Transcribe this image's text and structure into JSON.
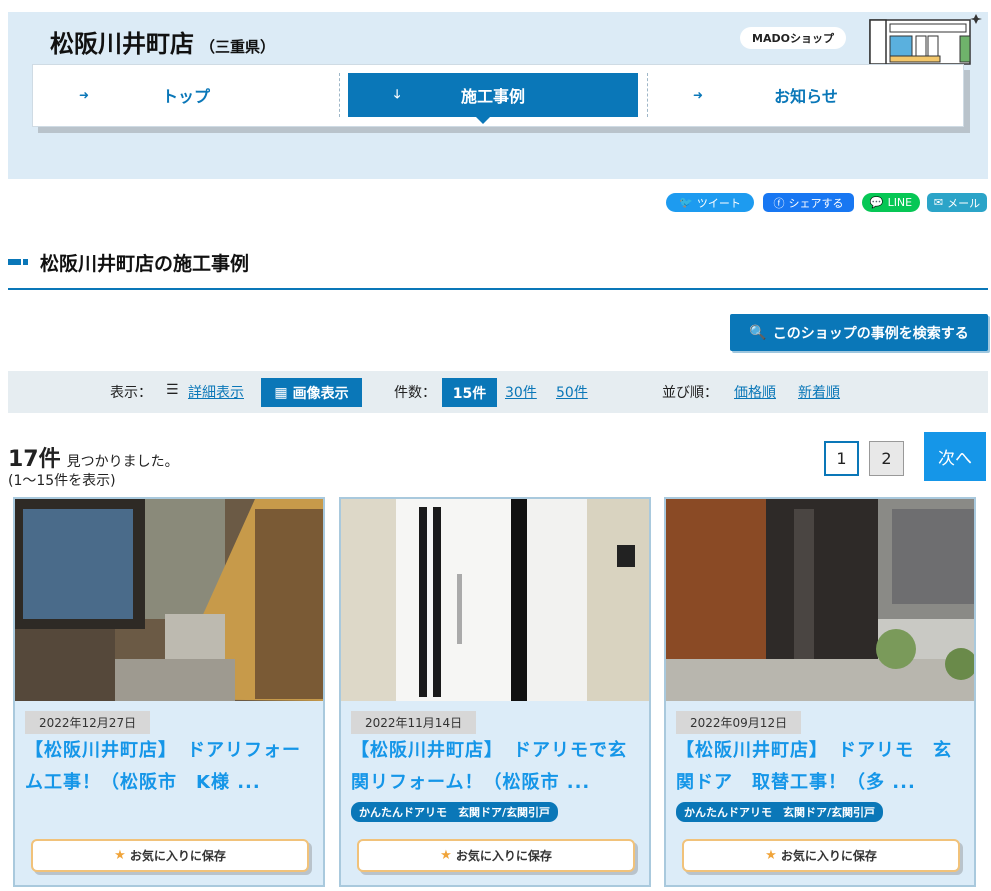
{
  "header": {
    "shop_name": "松阪川井町店",
    "prefecture": "（三重県）",
    "badge": "MADOショップ"
  },
  "nav": {
    "items": [
      {
        "label": "トップ"
      },
      {
        "label": "施工事例"
      },
      {
        "label": "お知らせ"
      }
    ]
  },
  "share": {
    "tweet": "ツイート",
    "facebook": "シェアする",
    "line": "LINE",
    "mail": "メール"
  },
  "section": {
    "title": "松阪川井町店の施工事例",
    "search_button": "このショップの事例を検索する"
  },
  "filter": {
    "display_label": "表示：",
    "detail": "詳細表示",
    "image": "画像表示",
    "count_label": "件数：",
    "count_options": [
      "15件",
      "30件",
      "50件"
    ],
    "sort_label": "並び順：",
    "sort_price": "価格順",
    "sort_new": "新着順"
  },
  "results": {
    "count": "17件",
    "found": "見つかりました。",
    "range": "(1〜15件を表示)",
    "pages": [
      "1",
      "2"
    ],
    "next": "次へ"
  },
  "cards": [
    {
      "date": "2022年12月27日",
      "title": "【松阪川井町店】　ドアリフォーム工事！（松阪市　K様 ...",
      "tag": "",
      "fav": "お気に入りに保存"
    },
    {
      "date": "2022年11月14日",
      "title": "【松阪川井町店】　ドアリモで玄関リフォーム！（松阪市 ...",
      "tag": "かんたんドアリモ　玄関ドア/玄関引戸",
      "fav": "お気に入りに保存"
    },
    {
      "date": "2022年09月12日",
      "title": "【松阪川井町店】　ドアリモ　玄関ドア　取替工事！（多 ...",
      "tag": "かんたんドアリモ　玄関ドア/玄関引戸",
      "fav": "お気に入りに保存"
    }
  ]
}
